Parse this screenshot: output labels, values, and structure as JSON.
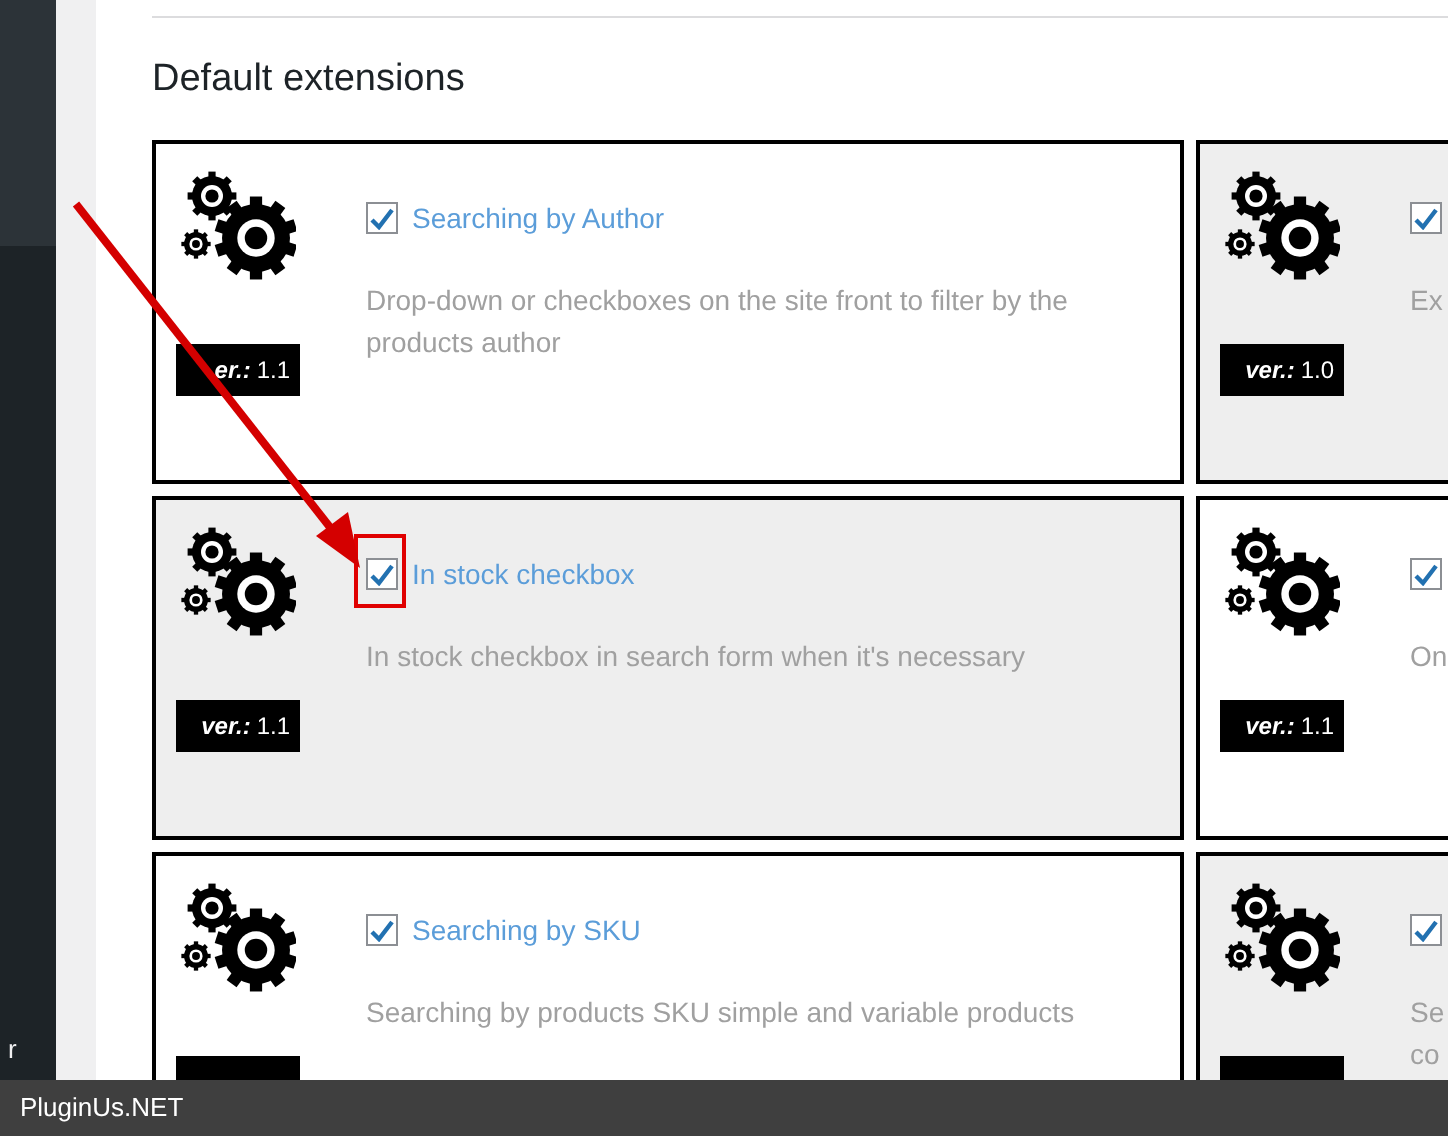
{
  "sidebar": {
    "fragment": "r"
  },
  "heading": "Default extensions",
  "cards": [
    {
      "title": "Searching by Author",
      "description": "Drop-down or checkboxes on the site front to filter by the products author",
      "version_label": "er.:",
      "version": "1.1",
      "checked": true,
      "shaded": false,
      "highlighted": false
    },
    {
      "description": "Ex",
      "version_label": "ver.:",
      "version": "1.0",
      "checked": true,
      "shaded": true,
      "highlighted": false
    },
    {
      "title": "In stock checkbox",
      "description": "In stock checkbox in search form when it's necessary",
      "version_label": "ver.:",
      "version": "1.1",
      "checked": true,
      "shaded": true,
      "highlighted": true
    },
    {
      "description": "On",
      "version_label": "ver.:",
      "version": "1.1",
      "checked": true,
      "shaded": false,
      "highlighted": false
    },
    {
      "title": "Searching by SKU",
      "description": "Searching by products SKU simple and variable products",
      "checked": true,
      "shaded": false,
      "highlighted": false
    },
    {
      "description": "Se\nco",
      "checked": true,
      "shaded": true,
      "highlighted": false
    }
  ],
  "footer": "PluginUs.NET"
}
